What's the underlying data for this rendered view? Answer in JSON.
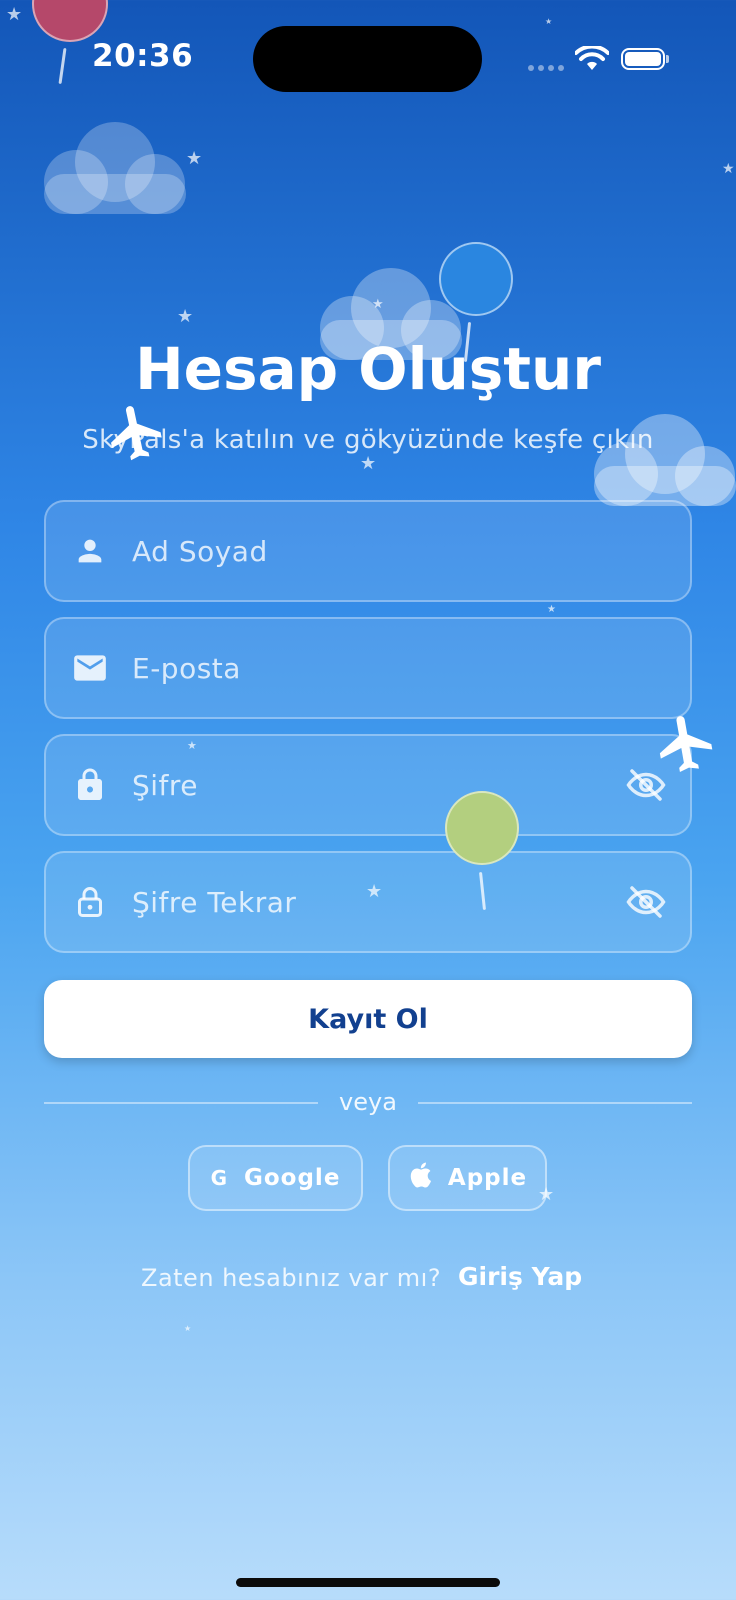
{
  "status_bar": {
    "time": "20:36"
  },
  "header": {
    "title": "Hesap Oluştur",
    "subtitle": "SkyPals'a katılın ve gökyüzünde keşfe çıkın"
  },
  "form": {
    "full_name": {
      "placeholder": "Ad Soyad",
      "icon": "person-icon"
    },
    "email": {
      "placeholder": "E-posta",
      "icon": "mail-icon"
    },
    "password": {
      "placeholder": "Şifre",
      "icon": "lock-icon",
      "toggle_icon": "eye-off-icon"
    },
    "password_confirm": {
      "placeholder": "Şifre Tekrar",
      "icon": "lock-outline-icon",
      "toggle_icon": "eye-off-icon"
    },
    "submit_label": "Kayıt Ol"
  },
  "divider_text": "veya",
  "social": {
    "google_label": "Google",
    "apple_label": "Apple"
  },
  "footer": {
    "question": "Zaten hesabınız var mı?",
    "login_link": "Giriş Yap"
  },
  "colors": {
    "gradient_top": "#1356b8",
    "gradient_bottom": "#b7dcfb",
    "primary_text": "#12408f"
  }
}
